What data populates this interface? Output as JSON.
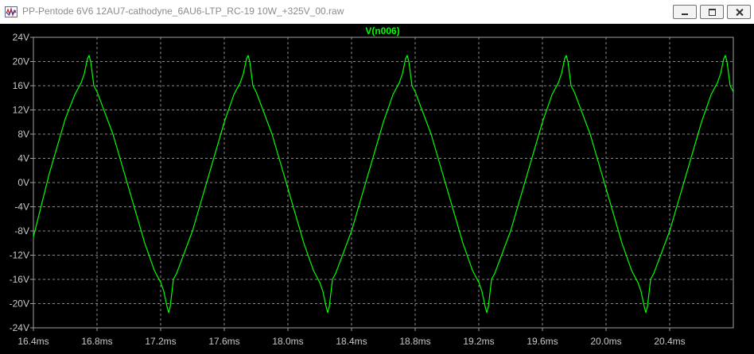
{
  "window": {
    "title": "PP-Pentode 6V6 12AU7-cathodyne_6AU6-LTP_RC-19 10W_+325V_00.raw",
    "app_icon": "waveform-viewer-icon"
  },
  "colors": {
    "background": "#000000",
    "trace": "#00ff00",
    "grid": "#8a8a8a",
    "tick_text": "#c8c8c8"
  },
  "chart_data": {
    "type": "line",
    "title": "V(n006)",
    "xlabel": "",
    "ylabel": "",
    "xlim": [
      16.4,
      20.8
    ],
    "ylim": [
      -24,
      24
    ],
    "grid": true,
    "x_ticks": [
      "16.4ms",
      "16.8ms",
      "17.2ms",
      "17.6ms",
      "18.0ms",
      "18.4ms",
      "18.8ms",
      "19.2ms",
      "19.6ms",
      "20.0ms",
      "20.4ms"
    ],
    "y_ticks": [
      "24V",
      "20V",
      "16V",
      "12V",
      "8V",
      "4V",
      "0V",
      "-4V",
      "-8V",
      "-12V",
      "-16V",
      "-20V",
      "-24V"
    ],
    "series": [
      {
        "name": "V(n006)",
        "color": "#00ff00",
        "x": [
          16.4,
          16.5,
          16.6,
          16.66,
          16.7,
          16.72,
          16.74,
          16.75,
          16.76,
          16.78,
          16.8,
          16.9,
          17.0,
          17.1,
          17.16,
          17.2,
          17.22,
          17.24,
          17.25,
          17.26,
          17.28,
          17.3,
          17.4,
          17.5,
          17.6,
          17.66,
          17.7,
          17.72,
          17.74,
          17.75,
          17.76,
          17.78,
          17.8,
          17.9,
          18.0,
          18.1,
          18.16,
          18.2,
          18.22,
          18.24,
          18.25,
          18.26,
          18.28,
          18.3,
          18.4,
          18.5,
          18.6,
          18.66,
          18.7,
          18.72,
          18.74,
          18.75,
          18.76,
          18.78,
          18.8,
          18.9,
          19.0,
          19.1,
          19.16,
          19.2,
          19.22,
          19.24,
          19.25,
          19.26,
          19.28,
          19.3,
          19.4,
          19.5,
          19.6,
          19.66,
          19.7,
          19.72,
          19.74,
          19.75,
          19.76,
          19.78,
          19.8,
          19.9,
          20.0,
          20.1,
          20.16,
          20.2,
          20.22,
          20.24,
          20.25,
          20.26,
          20.28,
          20.3,
          20.4,
          20.5,
          20.6,
          20.66,
          20.7,
          20.72,
          20.74,
          20.75,
          20.76,
          20.78,
          20.8
        ],
        "values": [
          -9,
          1.5,
          10.5,
          14.5,
          16.5,
          18,
          20.5,
          21,
          20,
          16,
          15,
          8,
          -1,
          -10,
          -14.5,
          -16.5,
          -18,
          -20.5,
          -21.5,
          -20.5,
          -16,
          -15,
          -8,
          1,
          10,
          14.5,
          16.5,
          18,
          20.5,
          21,
          20,
          16,
          15,
          8,
          -1,
          -10,
          -14.5,
          -16.5,
          -18,
          -20.5,
          -21.5,
          -20.5,
          -16,
          -15,
          -8,
          1,
          10,
          14.5,
          16.5,
          18,
          20.5,
          21,
          20,
          16,
          15,
          8,
          -1,
          -10,
          -14.5,
          -16.5,
          -18,
          -20.5,
          -21.5,
          -20.5,
          -16,
          -15,
          -8,
          1,
          10,
          14.5,
          16.5,
          18,
          20.5,
          21,
          20,
          16,
          15,
          8,
          -1,
          -10,
          -14.5,
          -16.5,
          -18,
          -20.5,
          -21.5,
          -20.5,
          -16,
          -15,
          -8,
          1,
          10,
          14.5,
          16.5,
          18,
          20.5,
          21,
          20,
          16,
          15
        ]
      }
    ]
  }
}
